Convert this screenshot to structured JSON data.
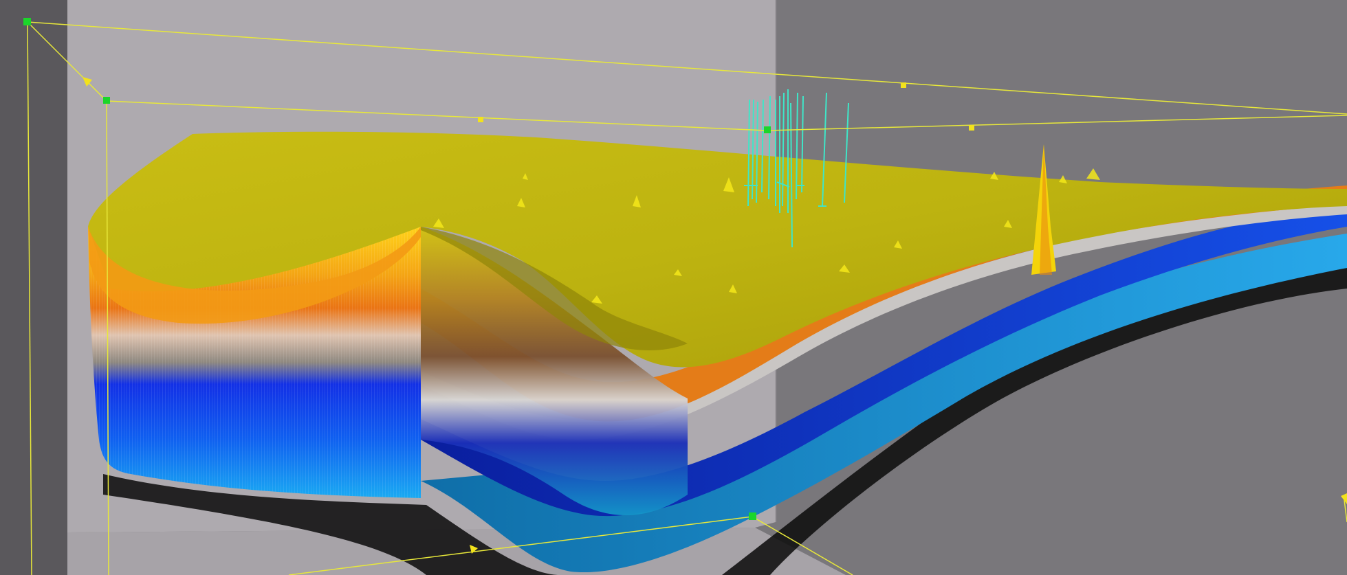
{
  "scene": {
    "type": "3d-geological-model-viewport",
    "colors": {
      "background_room": "#79777b",
      "back_wall_light": "#ada9ae",
      "left_wall_dark": "#5a585c",
      "floor": "#a7a3a8",
      "bounding_box_line": "#e8e83a",
      "box_handle_corner": "#1bd62a",
      "box_handle_edge": "#f2e21c",
      "well_trajectory": "#3fe6c8",
      "layer_top_surface": "#c4b812",
      "layer_orange": "#e8821a",
      "layer_tan": "#b89a80",
      "layer_gray": "#8e8c8a",
      "layer_deep_blue": "#0b2ad8",
      "layer_light_blue": "#1b9ae6"
    },
    "icons": [
      "box-corner-handle-icon",
      "box-edge-handle-icon",
      "resize-arrow-icon"
    ]
  }
}
